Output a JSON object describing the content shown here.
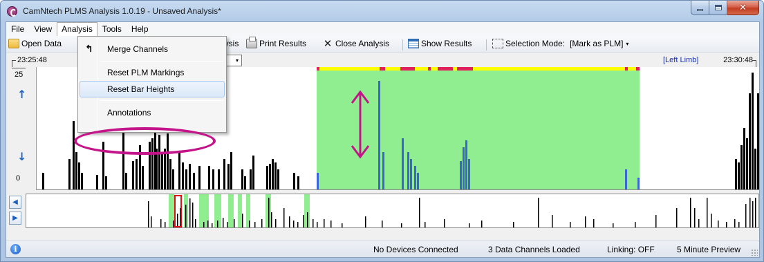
{
  "window": {
    "title": "CamNtech PLMS Analysis 1.0.19 - Unsaved Analysis*",
    "controls": {
      "minimize": "minimize",
      "maximize": "maximize",
      "close": "✕"
    }
  },
  "menubar": {
    "items": [
      "File",
      "View",
      "Analysis",
      "Tools",
      "Help"
    ],
    "open_item": "Analysis"
  },
  "toolbar": {
    "open_data": "Open Data",
    "analysis_partial": "lysis",
    "print_results": "Print Results",
    "close_analysis": "Close Analysis",
    "show_results": "Show Results",
    "selection_mode_label": "Selection Mode:",
    "selection_mode_value": "[Mark as PLM]",
    "caret": "▾"
  },
  "analysis_menu": {
    "items": [
      {
        "label": "Merge Channels",
        "icon": "merge-arrow-icon"
      },
      {
        "label": "Reset PLM Markings"
      },
      {
        "label": "Reset Bar Heights",
        "highlighted": true
      },
      {
        "label": "Annotations"
      }
    ]
  },
  "timeline": {
    "start_time": "23:25:48",
    "end_time": "23:30:48",
    "limb_label": "[Left Limb]",
    "combo_caret": "▾"
  },
  "y_axis": {
    "max": "25",
    "min": "0",
    "up_icon": "↑",
    "down_icon": "↓"
  },
  "overview": {
    "left_btn": "◀",
    "right_btn": "▶"
  },
  "colors": {
    "selection_green": "#90ee90",
    "event_blue": "#3c64d8",
    "mark_yellow": "#ffff00",
    "mark_red": "#e0205a",
    "annotation_magenta": "#c3148a"
  },
  "status": {
    "devices": "No Devices Connected",
    "channels": "3 Data Channels Loaded",
    "linking": "Linking: OFF",
    "preview": "5 Minute Preview",
    "info_icon": "i"
  }
}
